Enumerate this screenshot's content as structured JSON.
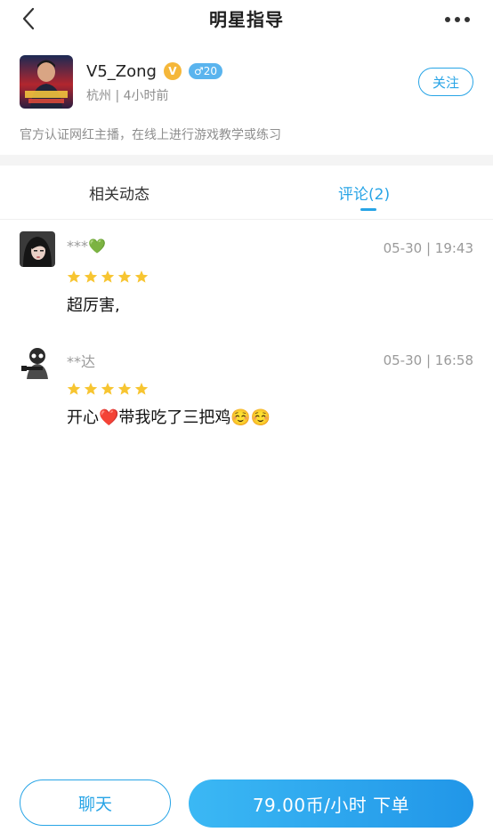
{
  "header": {
    "title": "明星指导",
    "back_icon": "chevron-left-icon",
    "more_icon": "more-dots-icon"
  },
  "profile": {
    "name": "V5_Zong",
    "verified_badge": "V",
    "gender_age": "♂20",
    "location_time": "杭州 | 4小时前",
    "follow_label": "关注",
    "description": "官方认证网红主播，在线上进行游戏教学或练习"
  },
  "tabs": [
    {
      "label": "相关动态",
      "active": false
    },
    {
      "label": "评论(2)",
      "active": true
    }
  ],
  "comments": [
    {
      "user": "***💚",
      "time": "05-30 | 19:43",
      "rating": 5,
      "text": "超厉害,"
    },
    {
      "user": "**达",
      "time": "05-30 | 16:58",
      "rating": 5,
      "text": "开心❤️带我吃了三把鸡☺️☺️"
    }
  ],
  "bottom": {
    "chat_label": "聊天",
    "order_label": "79.00币/小时  下单"
  },
  "colors": {
    "accent": "#27a4e6",
    "star": "#f7c531",
    "gray_text": "#9a9a9a"
  }
}
